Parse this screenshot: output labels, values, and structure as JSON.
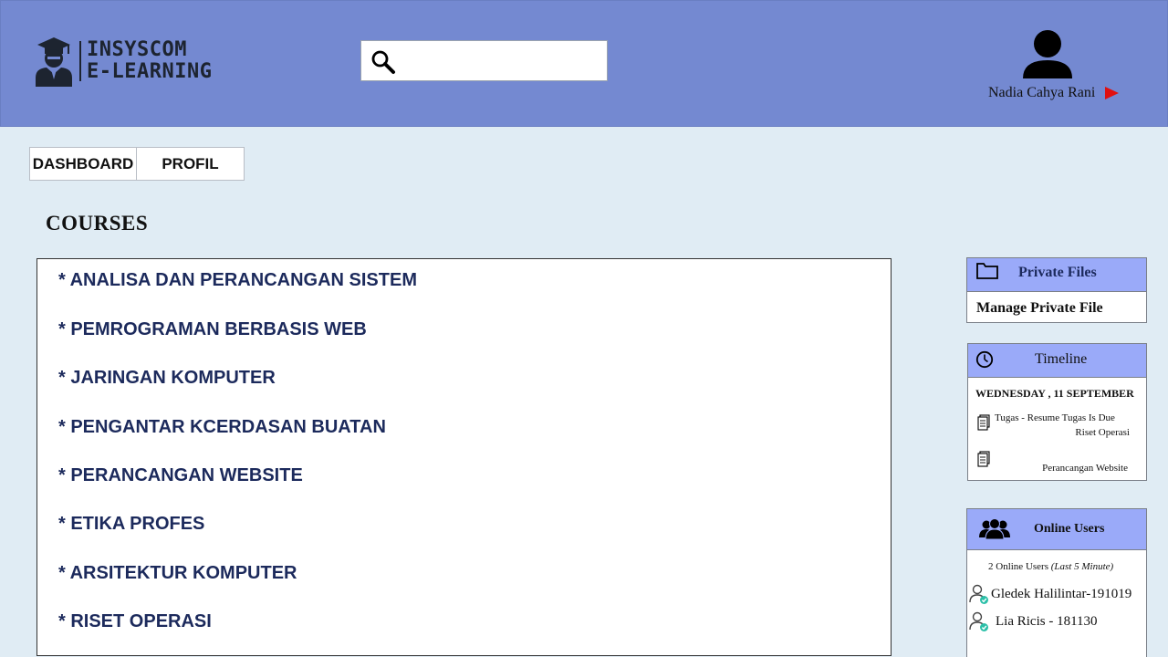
{
  "header": {
    "logo": {
      "line1": "INSYSCOM",
      "line2": "E-LEARNING"
    },
    "search": {
      "value": "",
      "placeholder": ""
    },
    "user": {
      "name": "Nadia Cahya Rani"
    }
  },
  "nav": {
    "tabs": [
      {
        "label": "DASHBOARD"
      },
      {
        "label": "PROFIL"
      }
    ]
  },
  "main": {
    "title": "COURSES",
    "courses": [
      "* ANALISA DAN PERANCANGAN SISTEM",
      "* PEMROGRAMAN BERBASIS WEB",
      "* JARINGAN KOMPUTER",
      "* PENGANTAR KCERDASAN BUATAN",
      "* PERANCANGAN WEBSITE",
      "* ETIKA PROFES",
      "* ARSITEKTUR KOMPUTER",
      "* RISET OPERASI"
    ]
  },
  "sidebar": {
    "private_files": {
      "title": "Private Files",
      "link": "Manage Private File"
    },
    "timeline": {
      "title": "Timeline",
      "date": "WEDNESDAY , 11 SEPTEMBER",
      "items": [
        {
          "line1": "Tugas  - Resume Tugas Is Due",
          "line2": "Riset Operasi"
        },
        {
          "line1": "",
          "line2": "Perancangan Website"
        }
      ]
    },
    "online_users": {
      "title": "Online Users",
      "count": "2 Online Users",
      "count_note": "(Last 5 Minute)",
      "users": [
        {
          "name": "Gledek Halilintar-191019"
        },
        {
          "name": "Lia Ricis - 181130"
        }
      ]
    }
  },
  "colors": {
    "header_bg": "#7489d1",
    "page_bg": "#e0ecf4",
    "widget_header": "#9aaaf9",
    "course_text": "#1c2a5c",
    "user_caret": "#e01010",
    "online_check": "#2bbfa8"
  },
  "icons": {
    "logo": "graduate-student-icon",
    "search": "search-icon",
    "avatar": "user-avatar-icon",
    "caret": "caret-right-icon",
    "folder": "folder-icon",
    "clock": "clock-icon",
    "document": "document-icon",
    "users": "users-group-icon",
    "user_online": "user-online-icon"
  }
}
